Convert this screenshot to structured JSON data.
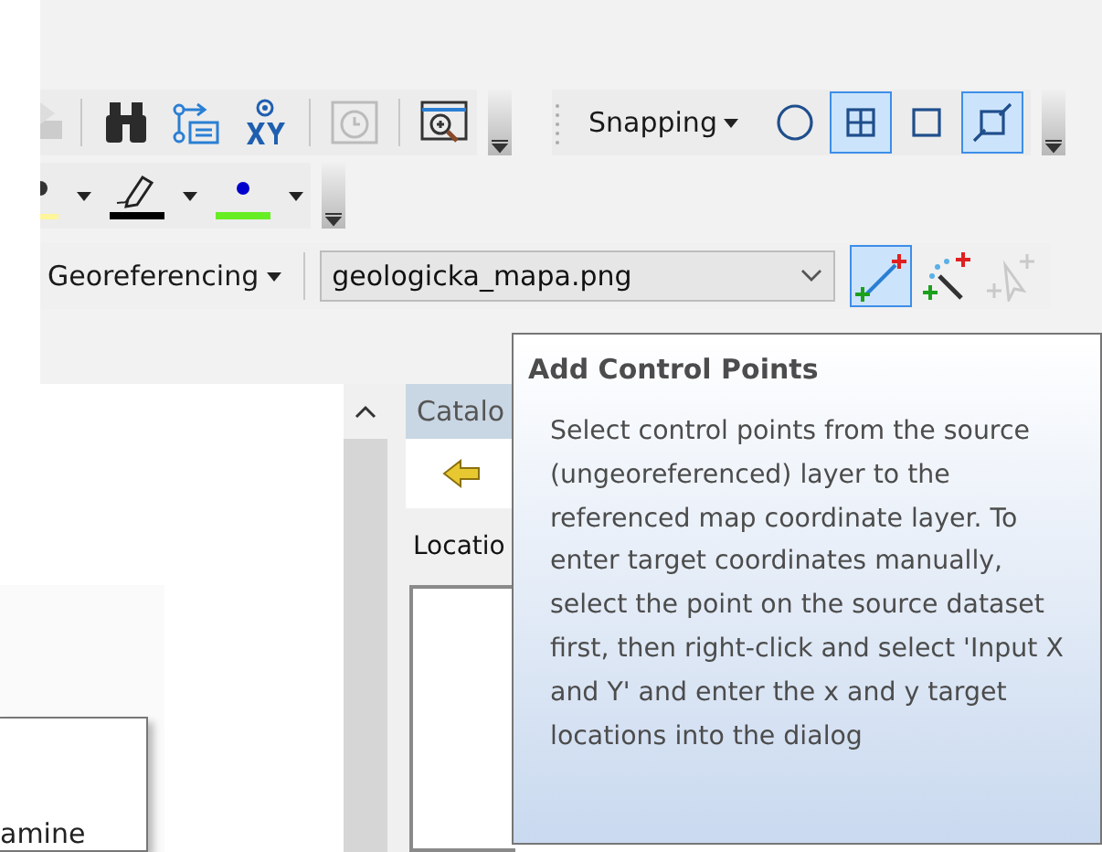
{
  "snapping": {
    "menu": "Snapping",
    "options": [
      {
        "kind": "point",
        "selected": false
      },
      {
        "kind": "vertex",
        "selected": true
      },
      {
        "kind": "edge",
        "selected": false
      },
      {
        "kind": "end",
        "selected": true
      }
    ]
  },
  "georeferencing": {
    "menu": "Georeferencing",
    "layer": "geologicka_mapa.png",
    "tools": [
      {
        "kind": "add",
        "selected": true,
        "disabled": false
      },
      {
        "kind": "auto",
        "selected": false,
        "disabled": false
      },
      {
        "kind": "select",
        "selected": false,
        "disabled": true
      }
    ]
  },
  "catalog": {
    "title": "Catalo",
    "location_label": "Locatio"
  },
  "tooltip": {
    "title": "Add Control Points",
    "text": "Select control points from the source (ungeoreferenced) layer to the referenced map coordinate layer. To enter target coordinates manually, select the point on the source dataset first, then right-click and select 'Input X and Y' and enter the x and y target locations into the dialog"
  },
  "dialog_fragment": {
    "text": "amine"
  }
}
